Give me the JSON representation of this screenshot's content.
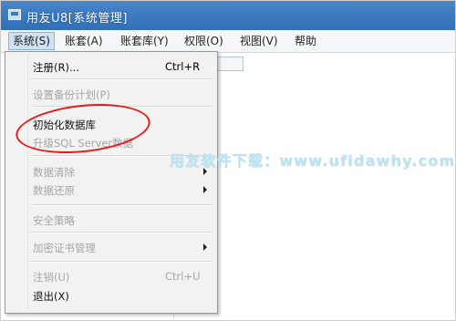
{
  "window": {
    "title": "用友U8[系统管理]"
  },
  "menubar": {
    "items": [
      "系统(S)",
      "账套(A)",
      "账套库(Y)",
      "权限(O)",
      "视图(V)",
      "帮助"
    ],
    "active_index": 0
  },
  "system_menu": {
    "items": [
      {
        "label": "注册(R)...",
        "shortcut": "Ctrl+R",
        "enabled": true,
        "submenu": false
      },
      {
        "label": "设置备份计划(P)",
        "shortcut": "",
        "enabled": false,
        "submenu": false
      },
      {
        "label": "初始化数据库",
        "shortcut": "",
        "enabled": true,
        "submenu": false
      },
      {
        "label": "升级SQL Server数据",
        "shortcut": "",
        "enabled": false,
        "submenu": false
      },
      {
        "label": "数据清除",
        "shortcut": "",
        "enabled": false,
        "submenu": true
      },
      {
        "label": "数据还原",
        "shortcut": "",
        "enabled": false,
        "submenu": true
      },
      {
        "label": "安全策略",
        "shortcut": "",
        "enabled": false,
        "submenu": false
      },
      {
        "label": "加密证书管理",
        "shortcut": "",
        "enabled": false,
        "submenu": true
      },
      {
        "label": "注销(U)",
        "shortcut": "Ctrl+U",
        "enabled": false,
        "submenu": false
      },
      {
        "label": "退出(X)",
        "shortcut": "",
        "enabled": true,
        "submenu": false
      }
    ]
  },
  "annotation": {
    "color": "#e0201c",
    "highlighted_item": "初始化数据库"
  },
  "watermark": {
    "text": "用友软件下载：www.ufidawhy.com"
  },
  "colors": {
    "titlebar": "#3a79bf",
    "menu_active": "#cfe1f3",
    "disabled_text": "#a6a6a6"
  }
}
